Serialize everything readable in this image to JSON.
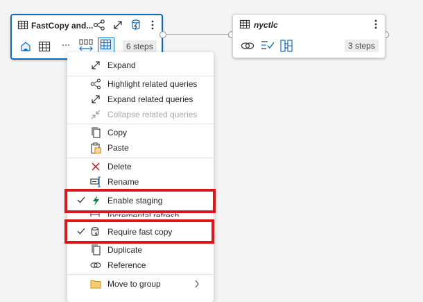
{
  "nodes": {
    "source": {
      "title": "FastCopy and...",
      "steps": "6 steps"
    },
    "target": {
      "title": "nyctlc",
      "steps": "3 steps"
    }
  },
  "menu": {
    "expand": "Expand",
    "highlight_related": "Highlight related queries",
    "expand_related": "Expand related queries",
    "collapse_related": "Collapse related queries",
    "copy": "Copy",
    "paste": "Paste",
    "delete": "Delete",
    "rename": "Rename",
    "enable_staging": "Enable staging",
    "incremental_refresh": "Incremental refresh",
    "require_fast_copy": "Require fast copy",
    "duplicate": "Duplicate",
    "reference": "Reference",
    "move_to_group": "Move to group"
  },
  "colors": {
    "accent": "#0f6cbd",
    "highlight_box": "#d9161b",
    "staging_bolt": "#107c41",
    "delete_x": "#c50f1f",
    "folder": "#e8a93c"
  }
}
